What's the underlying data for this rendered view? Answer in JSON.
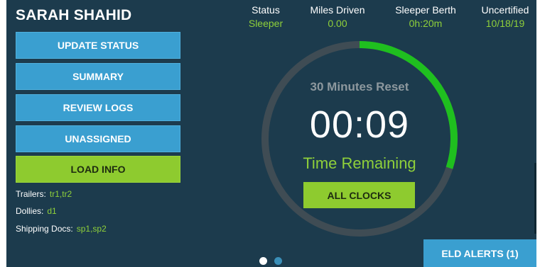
{
  "driver": {
    "name": "SARAH SHAHID"
  },
  "menu": {
    "update_status": "UPDATE STATUS",
    "summary": "SUMMARY",
    "review_logs": "REVIEW LOGS",
    "unassigned": "UNASSIGNED",
    "load_info": "LOAD INFO"
  },
  "load": {
    "trailers_label": "Trailers:",
    "trailers_value": "tr1,tr2",
    "dollies_label": "Dollies:",
    "dollies_value": "d1",
    "shipping_label": "Shipping Docs:",
    "shipping_value": "sp1,sp2"
  },
  "stats": {
    "status_label": "Status",
    "status_value": "Sleeper",
    "miles_label": "Miles Driven",
    "miles_value": "0.00",
    "sleeper_label": "Sleeper Berth",
    "sleeper_value": "0h:20m",
    "uncert_label": "Uncertified",
    "uncert_value": "10/18/19"
  },
  "clock": {
    "title": "30 Minutes Reset",
    "time": "00:09",
    "subtitle": "Time Remaining",
    "remaining_fraction": 0.3,
    "all_clocks_label": "ALL CLOCKS"
  },
  "alerts": {
    "label": "ELD ALERTS (1)"
  },
  "pager": {
    "pages": 2,
    "active": 1
  },
  "colors": {
    "background": "#1c3b4d",
    "primary_button": "#3a9fd0",
    "accent_green": "#8ecb2f",
    "progress_green": "#1fbf1f",
    "track": "#3f4c54"
  }
}
